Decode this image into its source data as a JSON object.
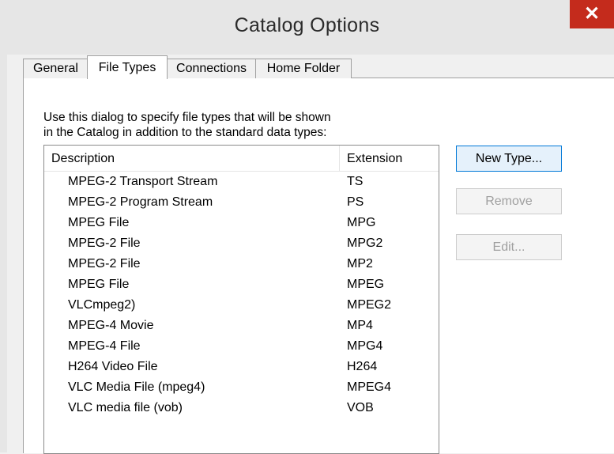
{
  "window": {
    "title": "Catalog Options",
    "close_symbol": "✕"
  },
  "tabs": [
    {
      "label": "General",
      "selected": false
    },
    {
      "label": "File Types",
      "selected": true
    },
    {
      "label": "Connections",
      "selected": false
    },
    {
      "label": "Home Folder",
      "selected": false
    }
  ],
  "instructions": {
    "line1": "Use this dialog to specify file types that will be shown",
    "line2": "in the Catalog in addition to the standard data types:"
  },
  "list": {
    "headers": {
      "description": "Description",
      "extension": "Extension"
    },
    "rows": [
      {
        "description": "MPEG-2 Transport Stream",
        "extension": "TS"
      },
      {
        "description": "MPEG-2 Program Stream",
        "extension": "PS"
      },
      {
        "description": "MPEG File",
        "extension": "MPG"
      },
      {
        "description": "MPEG-2 File",
        "extension": "MPG2"
      },
      {
        "description": "MPEG-2 File",
        "extension": "MP2"
      },
      {
        "description": "MPEG File",
        "extension": "MPEG"
      },
      {
        "description": "VLCmpeg2)",
        "extension": "MPEG2"
      },
      {
        "description": "MPEG-4 Movie",
        "extension": "MP4"
      },
      {
        "description": "MPEG-4 File",
        "extension": "MPG4"
      },
      {
        "description": "H264 Video File",
        "extension": "H264"
      },
      {
        "description": "VLC Media File (mpeg4)",
        "extension": "MPEG4"
      },
      {
        "description": "VLC media file (vob)",
        "extension": "VOB"
      }
    ]
  },
  "buttons": {
    "new_type": "New Type...",
    "remove": "Remove",
    "edit": "Edit..."
  },
  "colors": {
    "close_button": "#c42b1c",
    "default_button_border": "#0078d7",
    "disabled_text": "#a0a0a0"
  }
}
